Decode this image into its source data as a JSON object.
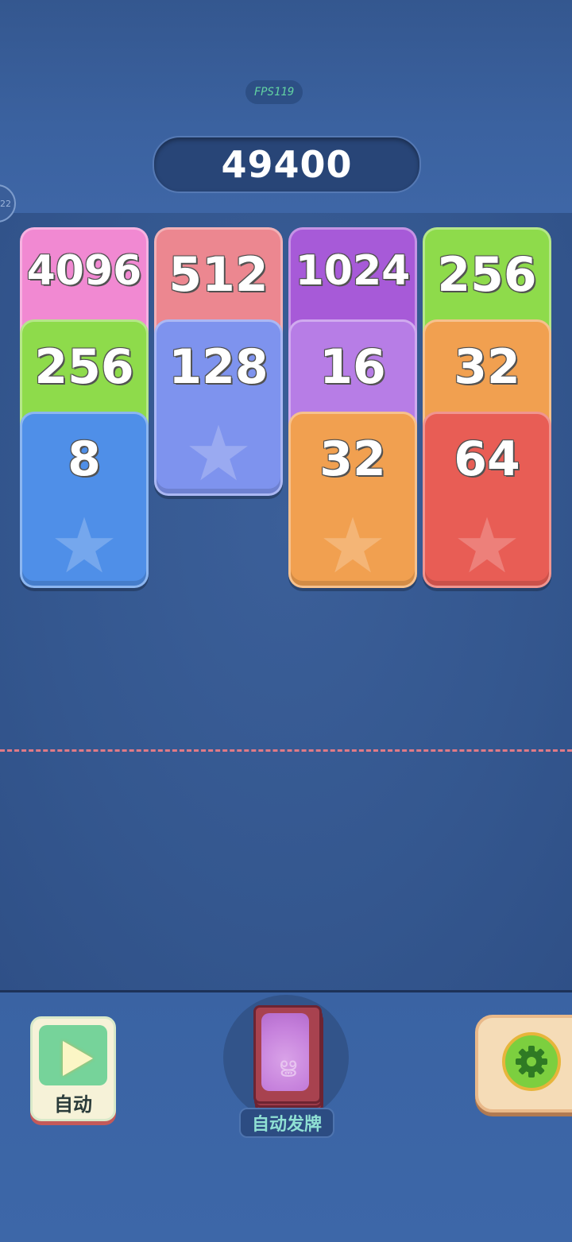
{
  "hud": {
    "fps": "FPS119",
    "score": "49400",
    "edge_badge": "22"
  },
  "columns": [
    {
      "cards": [
        {
          "value": "4096",
          "color": "#f189d2"
        },
        {
          "value": "256",
          "color": "#8edb4b"
        },
        {
          "value": "8",
          "color": "#4f8fe8"
        }
      ]
    },
    {
      "cards": [
        {
          "value": "512",
          "color": "#ec8790"
        },
        {
          "value": "128",
          "color": "#7e93ee"
        }
      ]
    },
    {
      "cards": [
        {
          "value": "1024",
          "color": "#a75ad8"
        },
        {
          "value": "16",
          "color": "#b77de6"
        },
        {
          "value": "32",
          "color": "#f1a050"
        }
      ]
    },
    {
      "cards": [
        {
          "value": "256",
          "color": "#8edb4b"
        },
        {
          "value": "32",
          "color": "#f1a050"
        },
        {
          "value": "64",
          "color": "#e85d55"
        }
      ]
    }
  ],
  "controls": {
    "auto_label": "自动",
    "deal_label": "自动发牌",
    "icons": {
      "play": "play-icon",
      "settings": "gear-icon",
      "deck": "card-deck-icon"
    }
  }
}
